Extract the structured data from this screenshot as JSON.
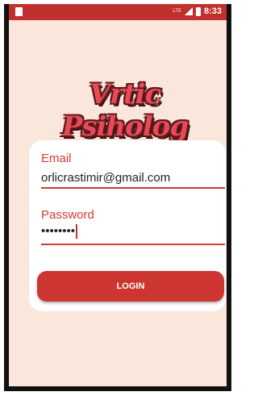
{
  "status_bar": {
    "network": "LTE",
    "time": "8:33"
  },
  "app": {
    "logo_text": "Vrtic Psiholog"
  },
  "form": {
    "email_label": "Email",
    "email_value": "orlicrastimir@gmail.com",
    "password_label": "Password",
    "password_masked": "••••••••",
    "login_label": "LOGIN"
  },
  "colors": {
    "accent": "#c0302c",
    "background": "#fbe6dc",
    "card": "#ffffff"
  }
}
